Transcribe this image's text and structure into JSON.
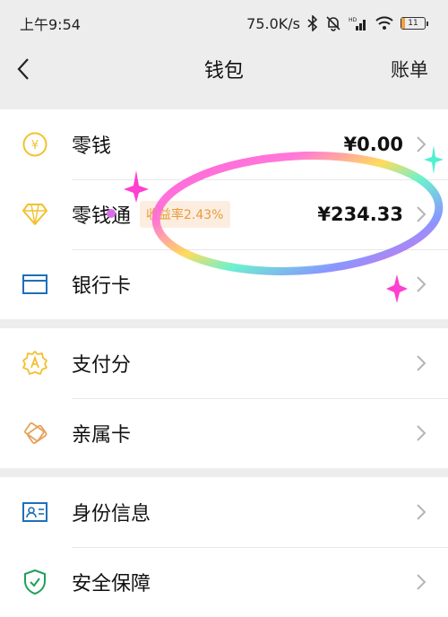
{
  "status_bar": {
    "time": "上午9:54",
    "speed": "75.0K/s",
    "battery_level": "11"
  },
  "nav": {
    "title": "钱包",
    "right_label": "账单"
  },
  "groups": [
    {
      "items": [
        {
          "label": "零钱",
          "value": "¥0.00",
          "icon": "coin-icon"
        },
        {
          "label": "零钱通",
          "badge": "收益率2.43%",
          "value": "¥234.33",
          "icon": "diamond-icon"
        },
        {
          "label": "银行卡",
          "icon": "bank-card-icon"
        }
      ]
    },
    {
      "items": [
        {
          "label": "支付分",
          "icon": "pay-score-icon"
        },
        {
          "label": "亲属卡",
          "icon": "family-card-icon"
        }
      ]
    },
    {
      "items": [
        {
          "label": "身份信息",
          "icon": "id-card-icon"
        },
        {
          "label": "安全保障",
          "icon": "shield-icon"
        }
      ]
    }
  ],
  "colors": {
    "accent_yellow": "#f2c12e",
    "accent_blue": "#1f6fb8",
    "accent_green": "#1fa05a",
    "badge_orange": "#e99a3c"
  }
}
